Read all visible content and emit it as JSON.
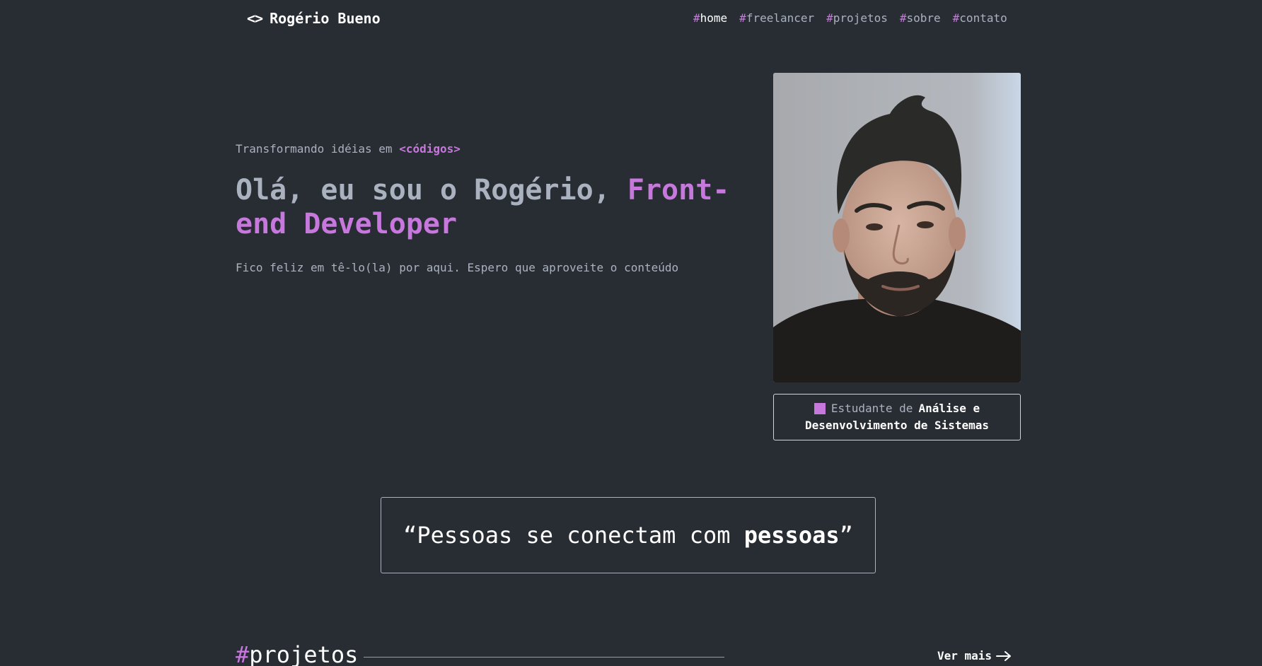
{
  "header": {
    "logo_icon": "<>",
    "logo_text": "Rogério Bueno",
    "nav": [
      {
        "hash": "#",
        "label": "home",
        "active": true
      },
      {
        "hash": "#",
        "label": "freelancer",
        "active": false
      },
      {
        "hash": "#",
        "label": "projetos",
        "active": false
      },
      {
        "hash": "#",
        "label": "sobre",
        "active": false
      },
      {
        "hash": "#",
        "label": "contato",
        "active": false
      }
    ]
  },
  "hero": {
    "tagline_prefix": "Transformando idéias em ",
    "tagline_code": "<códigos>",
    "headline_prefix": "Olá, eu sou o Rogério, ",
    "headline_role": "Front-end Developer",
    "subtext": "Fico feliz em tê-lo(la) por aqui. Espero que aproveite o conteúdo"
  },
  "status": {
    "prefix": "Estudante de",
    "strong_1": "Análise e",
    "strong_2": "Desenvolvimento de Sistemas"
  },
  "quote": {
    "open": "“Pessoas se conectam com ",
    "strong": "pessoas",
    "close": "”"
  },
  "projects": {
    "hash": "#",
    "title": "projetos",
    "view_more": "Ver mais"
  },
  "colors": {
    "background": "#282c33",
    "accent": "#c778dd",
    "text": "#abb2bf",
    "white": "#ffffff"
  }
}
